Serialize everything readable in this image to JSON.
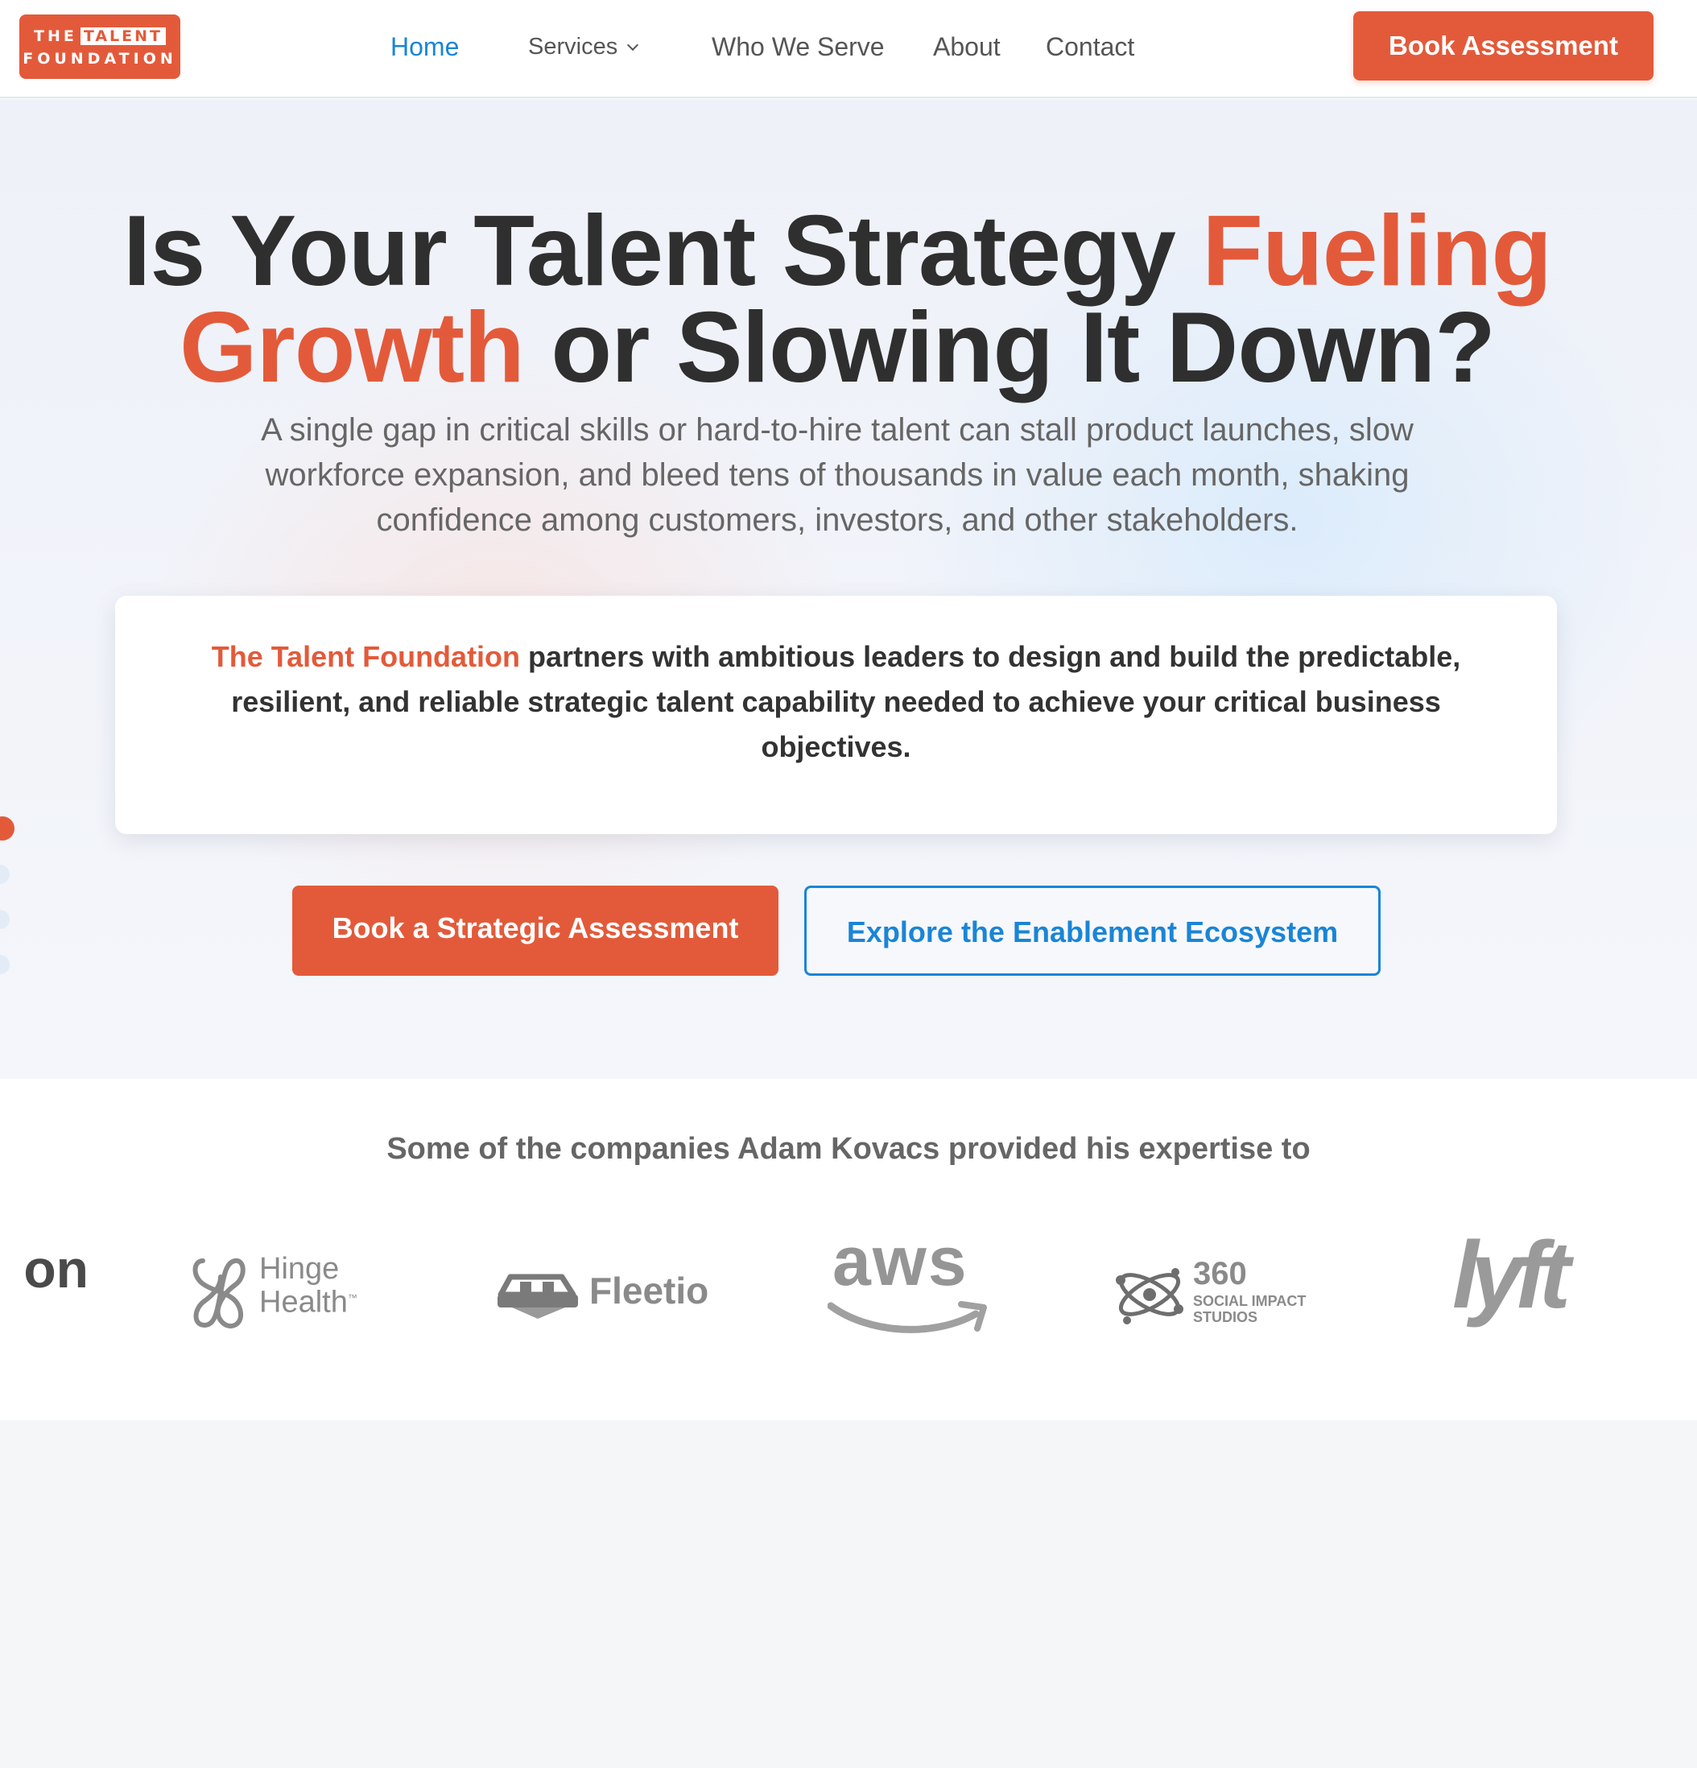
{
  "brand": {
    "logo_line1_prefix": "THE",
    "logo_line1_box": "TALENT",
    "logo_line2": "FOUNDATION",
    "accent_color": "#e35a3a",
    "link_color": "#1a85d6"
  },
  "nav": {
    "items": [
      {
        "label": "Home",
        "active": true
      },
      {
        "label": "Services",
        "has_dropdown": true
      },
      {
        "label": "Who We Serve"
      },
      {
        "label": "About"
      },
      {
        "label": "Contact"
      }
    ],
    "cta_label": "Book Assessment"
  },
  "hero": {
    "title_part1": "Is Your Talent Strategy ",
    "title_highlight1": "Fueling",
    "title_highlight2": "Growth",
    "title_part2": " or Slowing It Down?",
    "subtitle": "A single gap in critical skills or hard-to-hire talent can stall product launches, slow workforce expansion, and bleed tens of thousands in value each month, shaking confidence among customers, investors, and other stakeholders.",
    "card_brand": "The Talent Foundation",
    "card_text": " partners with ambitious leaders to design and build the predictable, resilient, and reliable strategic talent capability needed to achieve your critical business objectives.",
    "primary_cta": "Book a Strategic Assessment",
    "secondary_cta": "Explore the Enablement Ecosystem"
  },
  "clients": {
    "heading": "Some of the companies Adam Kovacs provided his expertise to",
    "logos": [
      {
        "name": "partial-logo",
        "text": "on"
      },
      {
        "name": "hinge-health",
        "line1": "Hinge",
        "line2": "Health",
        "tm": "™"
      },
      {
        "name": "fleetio",
        "text": "Fleetio"
      },
      {
        "name": "aws",
        "text": "aws"
      },
      {
        "name": "360-social-impact-studios",
        "big": "360",
        "small_line1": "SOCIAL IMPACT",
        "small_line2": "STUDIOS"
      },
      {
        "name": "lyft",
        "text": "lyft"
      }
    ]
  }
}
